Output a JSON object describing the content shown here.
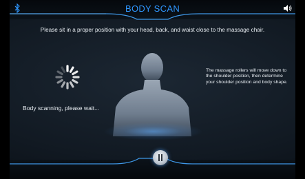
{
  "header": {
    "title": "BODY SCAN",
    "bluetooth_icon": "bluetooth-icon",
    "volume_icon": "volume-icon"
  },
  "instruction": "Please sit in a proper position with your head, back, and waist close to the massage chair.",
  "scan": {
    "status_text": "Body scanning, please wait...",
    "spinner_icon": "loading-spinner-icon"
  },
  "side_info": {
    "line1": "The massage rollers will move down to",
    "line2": "the shoulder position, then determine",
    "line3": "your shoulder position and body shape."
  },
  "controls": {
    "pause_icon": "pause-icon"
  },
  "colors": {
    "accent": "#2f97ff",
    "text": "#e9eef3",
    "glow": "#5aaaff"
  }
}
